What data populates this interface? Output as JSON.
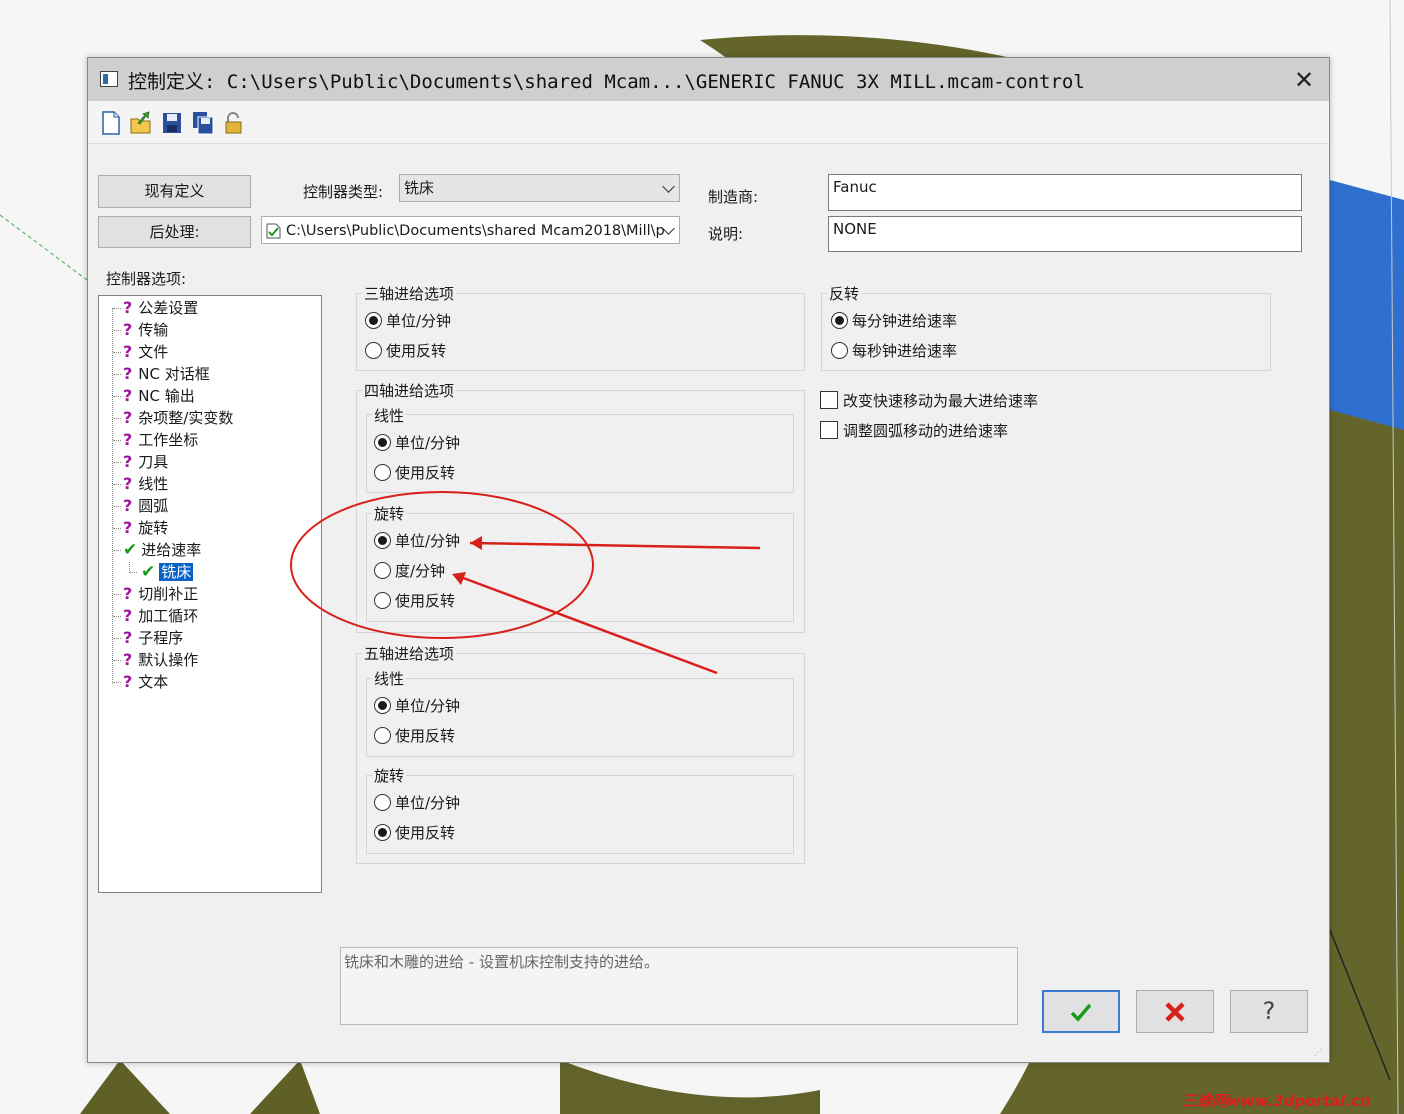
{
  "dialog": {
    "title": "控制定义: C:\\Users\\Public\\Documents\\shared Mcam...\\GENERIC FANUC 3X MILL.mcam-control",
    "close_glyph": "✕"
  },
  "toolbar": {
    "icons": [
      "new-file-icon",
      "open-folder-icon",
      "save-icon",
      "save-as-icon",
      "lock-icon"
    ]
  },
  "header": {
    "current_definition_button": "现有定义",
    "post_processor_button": "后处理:",
    "controller_type_label": "控制器类型:",
    "controller_type_value": "铣床",
    "post_path_value": "C:\\Users\\Public\\Documents\\shared Mcam2018\\Mill\\p",
    "manufacturer_label": "制造商:",
    "manufacturer_value": "Fanuc",
    "description_label": "说明:",
    "description_value": "NONE"
  },
  "tree": {
    "label": "控制器选项:",
    "items": [
      {
        "label": "公差设置",
        "state": "unknown"
      },
      {
        "label": "传输",
        "state": "unknown"
      },
      {
        "label": "文件",
        "state": "unknown"
      },
      {
        "label": "NC 对话框",
        "state": "unknown"
      },
      {
        "label": "NC 输出",
        "state": "unknown"
      },
      {
        "label": "杂项整/实变数",
        "state": "unknown"
      },
      {
        "label": "工作坐标",
        "state": "unknown"
      },
      {
        "label": "刀具",
        "state": "unknown"
      },
      {
        "label": "线性",
        "state": "unknown"
      },
      {
        "label": "圆弧",
        "state": "unknown"
      },
      {
        "label": "旋转",
        "state": "unknown"
      },
      {
        "label": "进给速率",
        "state": "checked"
      },
      {
        "label": "铣床",
        "state": "checked-selected"
      },
      {
        "label": "切削补正",
        "state": "unknown"
      },
      {
        "label": "加工循环",
        "state": "unknown"
      },
      {
        "label": "子程序",
        "state": "unknown"
      },
      {
        "label": "默认操作",
        "state": "unknown"
      },
      {
        "label": "文本",
        "state": "unknown"
      }
    ]
  },
  "three_axis": {
    "title": "三轴进给选项",
    "opt_unit": "单位/分钟",
    "opt_inverse": "使用反转",
    "selected": "unit"
  },
  "four_axis": {
    "title": "四轴进给选项",
    "linear": {
      "title": "线性",
      "opt_unit": "单位/分钟",
      "opt_inverse": "使用反转",
      "selected": "unit"
    },
    "rotary": {
      "title": "旋转",
      "opt_unit": "单位/分钟",
      "opt_degree": "度/分钟",
      "opt_inverse": "使用反转",
      "selected": "unit"
    }
  },
  "five_axis": {
    "title": "五轴进给选项",
    "linear": {
      "title": "线性",
      "opt_unit": "单位/分钟",
      "opt_inverse": "使用反转",
      "selected": "unit"
    },
    "rotary": {
      "title": "旋转",
      "opt_unit": "单位/分钟",
      "opt_inverse": "使用反转",
      "selected": "inverse"
    }
  },
  "inverse": {
    "title": "反转",
    "opt_per_minute": "每分钟进给速率",
    "opt_per_second": "每秒钟进给速率",
    "selected": "per_minute"
  },
  "checkboxes": {
    "rapid_to_max": {
      "label": "改变快速移动为最大进给速率",
      "checked": false
    },
    "adjust_arc": {
      "label": "调整圆弧移动的进给速率",
      "checked": false
    }
  },
  "help_text": "铣床和木雕的进给 - 设置机床控制支持的进给。",
  "footer": {
    "ok_icon": "check-icon",
    "cancel_icon": "red-x-icon",
    "help_glyph": "?"
  },
  "watermark": "三维网www.3dportal.cn",
  "colors": {
    "annotation_red": "#d8201a",
    "selection_blue": "#0a64c8",
    "question_purple": "#9b1a9b",
    "check_green": "#1a9a1a"
  }
}
